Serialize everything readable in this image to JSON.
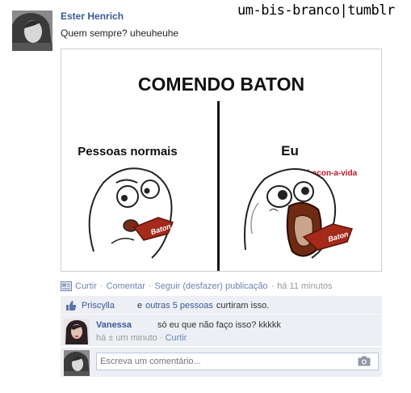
{
  "watermark": "um-bis-branco|tumblr",
  "post": {
    "author": "Ester Henrich",
    "text": "Quem sempre? uheuheuhe",
    "image": {
      "title": "COMENDO BATON",
      "left_label": "Pessoas normais",
      "right_label": "Eu",
      "right_watermark": "toddy-bacon-a-vida",
      "candy_label": "Baton"
    }
  },
  "actions": {
    "like": "Curtir",
    "comment": "Comentar",
    "follow": "Seguir (desfazer) publicação",
    "time": "há 11 minutos"
  },
  "likes": {
    "first_name": "Priscylla",
    "connector": "e",
    "others": "outras 5 pessoas",
    "suffix": "curtiram isso."
  },
  "comment": {
    "name": "Vanessa",
    "text": "só eu que não faço isso? kkkkk",
    "time": "há ± um minuto",
    "like": "Curtir"
  },
  "composer": {
    "placeholder": "Escreva um comentário..."
  },
  "icons": [
    "camera-icon",
    "thumbs-up-icon",
    "document-icon"
  ],
  "colors": {
    "link": "#3b5998",
    "muted_link": "#6d84b4",
    "box_bg": "#edeff4",
    "baton_red": "#8b2a1a"
  }
}
